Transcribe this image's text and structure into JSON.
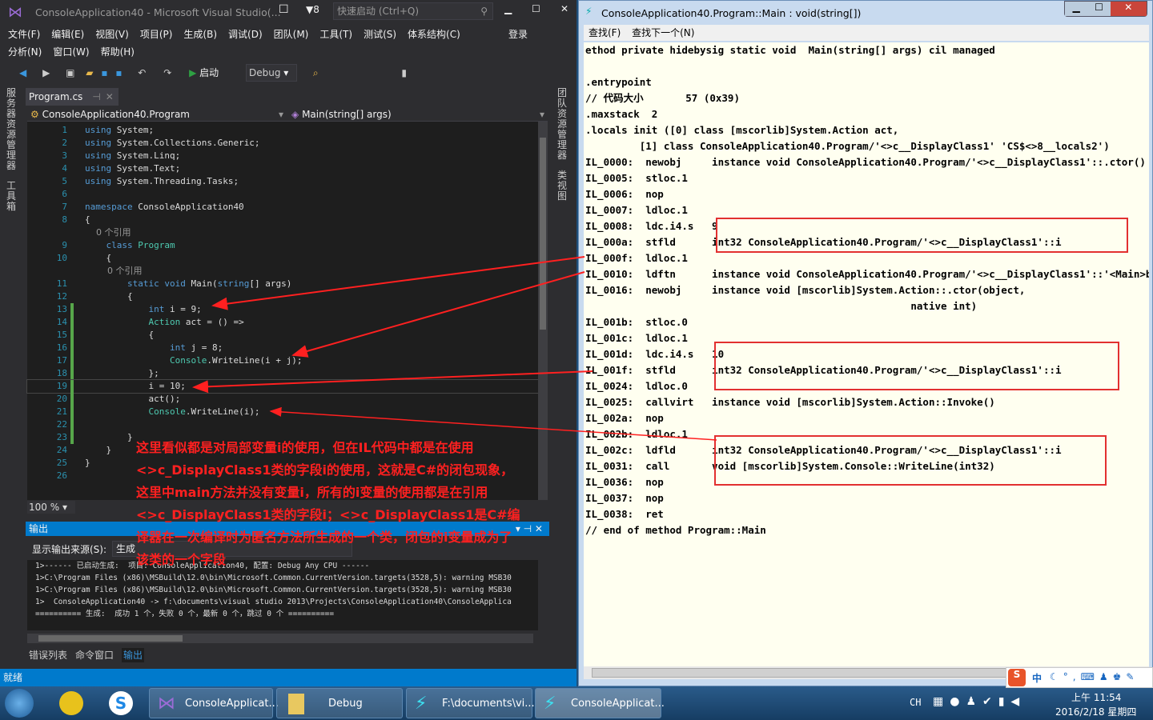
{
  "vs": {
    "title": "ConsoleApplication40 - Microsoft Visual Studio(...",
    "notif_count": "8",
    "quick_launch_placeholder": "快速启动 (Ctrl+Q)",
    "menu_row1": [
      "文件(F)",
      "编辑(E)",
      "视图(V)",
      "项目(P)",
      "生成(B)",
      "调试(D)",
      "团队(M)",
      "工具(T)",
      "测试(S)",
      "体系结构(C)"
    ],
    "login": "登录",
    "menu_row2": [
      "分析(N)",
      "窗口(W)",
      "帮助(H)"
    ],
    "start_label": "启动",
    "config": "Debug",
    "left_sidebar": [
      "服务器资源管理器",
      "工具箱"
    ],
    "right_sidebar": [
      "团队资源管理器",
      "类视图"
    ],
    "tab": "Program.cs",
    "nav_class": "ConsoleApplication40.Program",
    "nav_member": "Main(string[] args)",
    "zoom": "100 %",
    "code": [
      {
        "n": "1",
        "t": [
          [
            "using",
            "kw"
          ],
          [
            " System;",
            ""
          ]
        ]
      },
      {
        "n": "2",
        "t": [
          [
            "using",
            "kw"
          ],
          [
            " System.Collections.Generic;",
            ""
          ]
        ]
      },
      {
        "n": "3",
        "t": [
          [
            "using",
            "kw"
          ],
          [
            " System.Linq;",
            ""
          ]
        ]
      },
      {
        "n": "4",
        "t": [
          [
            "using",
            "kw"
          ],
          [
            " System.Text;",
            ""
          ]
        ]
      },
      {
        "n": "5",
        "t": [
          [
            "using",
            "kw"
          ],
          [
            " System.Threading.Tasks;",
            ""
          ]
        ]
      },
      {
        "n": "6",
        "t": []
      },
      {
        "n": "7",
        "t": [
          [
            "namespace",
            "kw"
          ],
          [
            " ConsoleApplication40",
            ""
          ]
        ]
      },
      {
        "n": "8",
        "t": [
          [
            "{",
            ""
          ]
        ]
      },
      {
        "n": "",
        "t": [
          [
            "    0 个引用",
            "lens"
          ]
        ]
      },
      {
        "n": "9",
        "t": [
          [
            "    ",
            ""
          ],
          [
            "class",
            "kw"
          ],
          [
            " ",
            ""
          ],
          [
            "Program",
            "ty"
          ]
        ]
      },
      {
        "n": "10",
        "t": [
          [
            "    {",
            ""
          ]
        ]
      },
      {
        "n": "",
        "t": [
          [
            "        0 个引用",
            "lens"
          ]
        ]
      },
      {
        "n": "11",
        "t": [
          [
            "        ",
            ""
          ],
          [
            "static void",
            "kw"
          ],
          [
            " Main(",
            ""
          ],
          [
            "string",
            "kw"
          ],
          [
            "[] args)",
            ""
          ]
        ]
      },
      {
        "n": "12",
        "t": [
          [
            "        {",
            ""
          ]
        ]
      },
      {
        "n": "13",
        "t": [
          [
            "            ",
            ""
          ],
          [
            "int",
            "kw"
          ],
          [
            " i = 9;",
            ""
          ]
        ]
      },
      {
        "n": "14",
        "t": [
          [
            "            ",
            ""
          ],
          [
            "Action",
            "ty"
          ],
          [
            " act = () =>",
            ""
          ]
        ]
      },
      {
        "n": "15",
        "t": [
          [
            "            {",
            ""
          ]
        ]
      },
      {
        "n": "16",
        "t": [
          [
            "                ",
            ""
          ],
          [
            "int",
            "kw"
          ],
          [
            " j = 8;",
            ""
          ]
        ]
      },
      {
        "n": "17",
        "t": [
          [
            "                ",
            ""
          ],
          [
            "Console",
            "ty"
          ],
          [
            ".WriteLine(i + j);",
            ""
          ]
        ]
      },
      {
        "n": "18",
        "t": [
          [
            "            };",
            ""
          ]
        ]
      },
      {
        "n": "19",
        "t": [
          [
            "            i = 10;",
            ""
          ]
        ]
      },
      {
        "n": "20",
        "t": [
          [
            "            act();",
            ""
          ]
        ]
      },
      {
        "n": "21",
        "t": [
          [
            "            ",
            ""
          ],
          [
            "Console",
            "ty"
          ],
          [
            ".WriteLine(i);",
            ""
          ]
        ]
      },
      {
        "n": "22",
        "t": []
      },
      {
        "n": "23",
        "t": [
          [
            "        }",
            ""
          ]
        ]
      },
      {
        "n": "24",
        "t": [
          [
            "    }",
            ""
          ]
        ]
      },
      {
        "n": "25",
        "t": [
          [
            "}",
            ""
          ]
        ]
      },
      {
        "n": "26",
        "t": []
      }
    ],
    "output_title": "输出",
    "output_source_label": "显示输出来源(S):",
    "output_source": "生成",
    "output_lines": [
      "1>------ 已启动生成:  项目: ConsoleApplication40, 配置: Debug Any CPU ------",
      "1>C:\\Program Files (x86)\\MSBuild\\12.0\\bin\\Microsoft.Common.CurrentVersion.targets(3528,5): warning MSB30",
      "1>C:\\Program Files (x86)\\MSBuild\\12.0\\bin\\Microsoft.Common.CurrentVersion.targets(3528,5): warning MSB30",
      "1>  ConsoleApplication40 -> f:\\documents\\visual studio 2013\\Projects\\ConsoleApplication40\\ConsoleApplica",
      "========== 生成:  成功 1 个，失败 0 个，最新 0 个，跳过 0 个 =========="
    ],
    "bottom_tabs": [
      "错误列表",
      "命令窗口",
      "输出"
    ],
    "status": "就绪"
  },
  "annotation": "这里看似都是对局部变量i的使用，但在IL代码中都是在使用<>c_DisplayClass1类的字段i的使用，这就是C#的闭包现象，这里中main方法并没有变量i，所有的i变量的使用都是在引用<>c_DisplayClass1类的字段i；<>c_DisplayClass1是C#编译器在一次编译时为匿名方法所生成的一个类，闭包的i变量成为了该类的一个字段",
  "il": {
    "title": "ConsoleApplication40.Program::Main : void(string[])",
    "menu": [
      "查找(F)",
      "查找下一个(N)"
    ],
    "lines": [
      "ethod private hidebysig static void  Main(string[] args) cil managed",
      "",
      ".entrypoint",
      "// 代码大小       57 (0x39)",
      ".maxstack  2",
      ".locals init ([0] class [mscorlib]System.Action act,",
      "         [1] class ConsoleApplication40.Program/'<>c__DisplayClass1' 'CS$<>8__locals2')",
      "IL_0000:  newobj     instance void ConsoleApplication40.Program/'<>c__DisplayClass1'::.ctor()",
      "IL_0005:  stloc.1",
      "IL_0006:  nop",
      "IL_0007:  ldloc.1",
      "IL_0008:  ldc.i4.s   9",
      "IL_000a:  stfld      int32 ConsoleApplication40.Program/'<>c__DisplayClass1'::i",
      "IL_000f:  ldloc.1",
      "IL_0010:  ldftn      instance void ConsoleApplication40.Program/'<>c__DisplayClass1'::'<Main>b__0'()",
      "IL_0016:  newobj     instance void [mscorlib]System.Action::.ctor(object,",
      "                                                      native int)",
      "IL_001b:  stloc.0",
      "IL_001c:  ldloc.1",
      "IL_001d:  ldc.i4.s   10",
      "IL_001f:  stfld      int32 ConsoleApplication40.Program/'<>c__DisplayClass1'::i",
      "IL_0024:  ldloc.0",
      "IL_0025:  callvirt   instance void [mscorlib]System.Action::Invoke()",
      "IL_002a:  nop",
      "IL_002b:  ldloc.1",
      "IL_002c:  ldfld      int32 ConsoleApplication40.Program/'<>c__DisplayClass1'::i",
      "IL_0031:  call       void [mscorlib]System.Console::WriteLine(int32)",
      "IL_0036:  nop",
      "IL_0037:  nop",
      "IL_0038:  ret",
      "// end of method Program::Main"
    ]
  },
  "taskbar": {
    "items": [
      "ConsoleApplicat...",
      "Debug",
      "F:\\documents\\vi...",
      "ConsoleApplicat..."
    ],
    "lang": "CH",
    "time": "上午 11:54",
    "date": "2016/2/18 星期四",
    "ime": "中"
  },
  "colors": {
    "vs_bg": "#2d2d30",
    "accent": "#007acc",
    "annotation": "#ff2020",
    "il_bg": "#fffff0"
  }
}
